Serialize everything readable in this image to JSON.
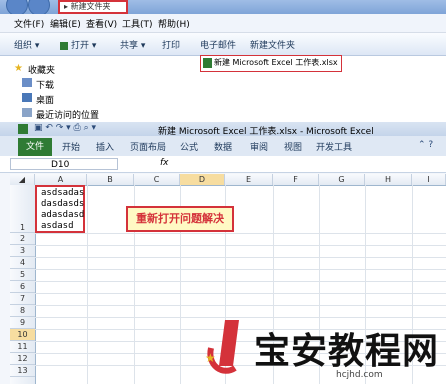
{
  "explorer": {
    "address_segment": "新建文件夹",
    "menu": [
      "文件(F)",
      "编辑(E)",
      "查看(V)",
      "工具(T)",
      "帮助(H)"
    ],
    "toolbar": [
      "组织",
      "打开",
      "共享",
      "打印",
      "电子邮件",
      "新建文件夹"
    ],
    "nav_items": [
      "收藏夹",
      "下载",
      "桌面",
      "最近访问的位置"
    ],
    "file_name": "新建 Microsoft Excel 工作表.xlsx"
  },
  "excel": {
    "title": "新建 Microsoft Excel 工作表.xlsx - Microsoft Excel",
    "file_tab": "文件",
    "tabs": [
      "开始",
      "插入",
      "页面布局",
      "公式",
      "数据",
      "审阅",
      "视图",
      "开发工具"
    ],
    "name_box": "D10",
    "fx_label": "fx",
    "columns": [
      "A",
      "B",
      "C",
      "D",
      "E",
      "F",
      "G",
      "H",
      "I"
    ],
    "rows": [
      "1",
      "2",
      "3",
      "4",
      "5",
      "6",
      "7",
      "8",
      "9",
      "10",
      "11",
      "12",
      "13"
    ],
    "cell_a1_lines": [
      "asdsadas",
      "dasdasds",
      "adasdasd",
      "asdasd"
    ],
    "callout": "重新打开问题解决"
  },
  "watermark": {
    "text": "宝安教程网",
    "url": "hcjhd.com"
  },
  "colors": {
    "highlight_red": "#d4323a",
    "file_tab_green": "#2f7b34",
    "callout_bg": "#fff9c4"
  }
}
